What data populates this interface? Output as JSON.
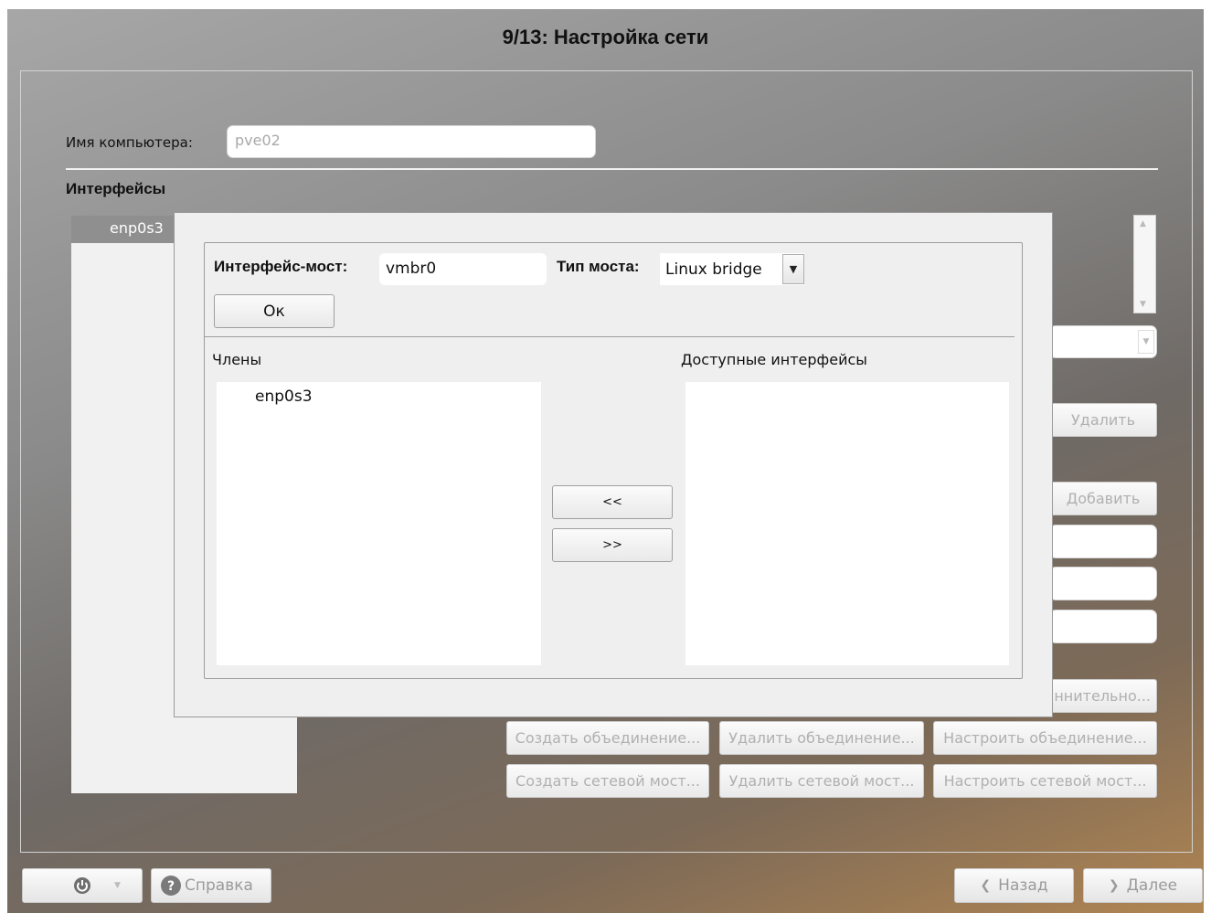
{
  "window": {
    "title": "9/13: Настройка сети"
  },
  "hostname": {
    "label": "Имя компьютера:",
    "value": "pve02"
  },
  "interfaces": {
    "heading": "Интерфейсы",
    "items": [
      "enp0s3"
    ]
  },
  "right_buttons": {
    "delete": "Удалить",
    "add": "Добавить",
    "additional": "ннительно..."
  },
  "bond_buttons": [
    "Создать объединение...",
    "Удалить объединение...",
    "Настроить объединение..."
  ],
  "bridge_buttons": [
    "Создать сетевой мост...",
    "Удалить сетевой мост...",
    "Настроить сетевой мост..."
  ],
  "dialog": {
    "bridge_label": "Интерфейс-мост:",
    "bridge_value": "vmbr0",
    "type_label": "Тип моста:",
    "type_value": "Linux bridge",
    "ok_label": "Ок",
    "members_label": "Члены",
    "available_label": "Доступные интерфейсы",
    "members": [
      "enp0s3"
    ],
    "available": [],
    "move_left": "<<",
    "move_right": ">>"
  },
  "footer": {
    "help": "Справка",
    "back": "Назад",
    "next": "Далее"
  },
  "icons": {
    "power": "power-icon",
    "help": "help-icon",
    "back": "chevron-left-icon",
    "next": "chevron-right-icon",
    "dropdown": "chevron-down-icon"
  }
}
